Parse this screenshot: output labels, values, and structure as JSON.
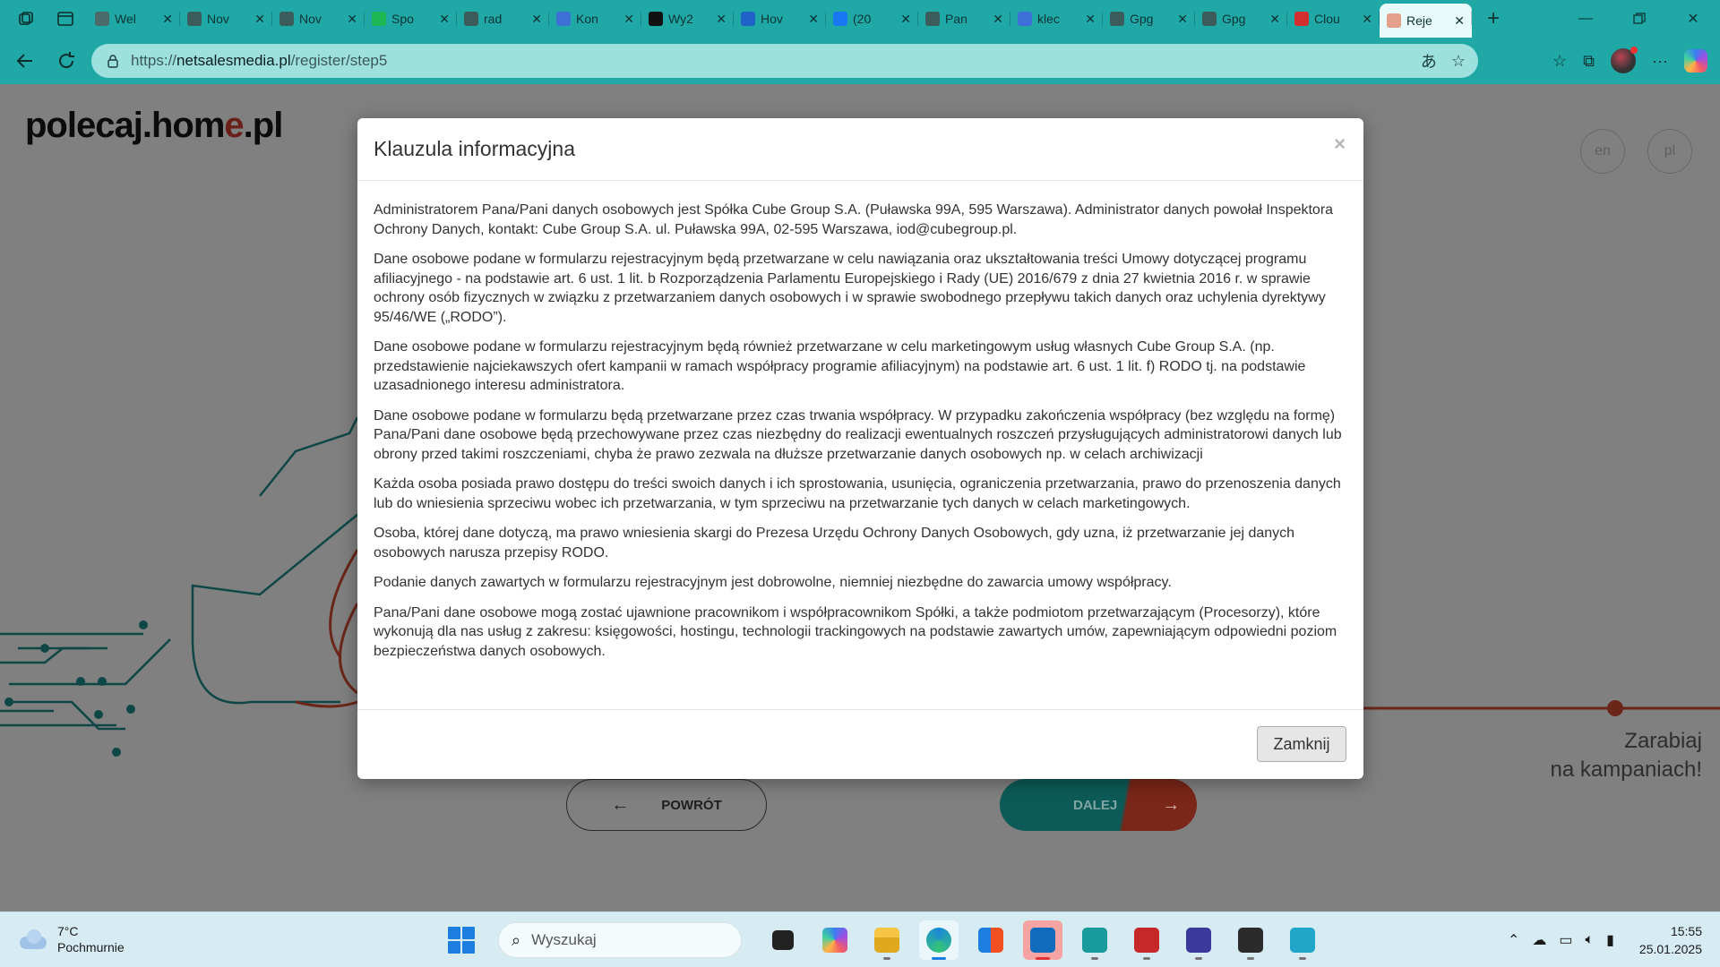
{
  "browser": {
    "tabs": [
      {
        "label": "Wel",
        "color": "#4a6b6a"
      },
      {
        "label": "Nov",
        "color": "#3b5c5b"
      },
      {
        "label": "Nov",
        "color": "#3b5c5b"
      },
      {
        "label": "Spo",
        "color": "#1db954"
      },
      {
        "label": "rad",
        "color": "#3b5c5b"
      },
      {
        "label": "Kon",
        "color": "#3d6fd6"
      },
      {
        "label": "Wy2",
        "color": "#111111"
      },
      {
        "label": "Hov",
        "color": "#1f63c9"
      },
      {
        "label": "(20",
        "color": "#1877f2"
      },
      {
        "label": "Pan",
        "color": "#3b5c5b"
      },
      {
        "label": "klec",
        "color": "#3d6fd6"
      },
      {
        "label": "Gpg",
        "color": "#3b5c5b"
      },
      {
        "label": "Gpg",
        "color": "#3b5c5b"
      },
      {
        "label": "Clou",
        "color": "#d32f2f"
      },
      {
        "label": "Reje",
        "color": "#e2a08d",
        "active": true
      }
    ],
    "url_prefix": "https://",
    "url_domain": "netsalesmedia.pl",
    "url_path": "/register/step5"
  },
  "page": {
    "logo_part1": "polecaj.hom",
    "logo_e": "e",
    "logo_part2": ".pl",
    "lang_en": "en",
    "lang_pl": "pl",
    "tagline_line1": "Zarabiaj",
    "tagline_line2": "na kampaniach!",
    "back_label": "POWRÓT",
    "next_label": "DALEJ"
  },
  "modal": {
    "title": "Klauzula informacyjna",
    "close_symbol": "×",
    "paragraphs": [
      "Administratorem Pana/Pani danych osobowych jest Spółka Cube Group S.A. (Puławska 99A, 595 Warszawa). Administrator danych powołał Inspektora Ochrony Danych, kontakt: Cube Group S.A. ul. Puławska 99A, 02-595 Warszawa, iod@cubegroup.pl.",
      "Dane osobowe podane w formularzu rejestracyjnym będą przetwarzane w celu nawiązania oraz ukształtowania treści Umowy dotyczącej programu afiliacyjnego - na podstawie art. 6 ust. 1 lit. b Rozporządzenia Parlamentu Europejskiego i Rady (UE) 2016/679 z dnia 27 kwietnia 2016 r. w sprawie ochrony osób fizycznych w związku z przetwarzaniem danych osobowych i w sprawie swobodnego przepływu takich danych oraz uchylenia dyrektywy 95/46/WE („RODO”).",
      "Dane osobowe podane w formularzu rejestracyjnym będą również przetwarzane w celu marketingowym usług własnych Cube Group S.A. (np. przedstawienie najciekawszych ofert kampanii w ramach współpracy programie afiliacyjnym) na podstawie art. 6 ust. 1 lit. f) RODO tj. na podstawie uzasadnionego interesu administratora.",
      "Dane osobowe podane w formularzu będą przetwarzane przez czas trwania współpracy. W przypadku zakończenia współpracy (bez względu na formę) Pana/Pani dane osobowe będą przechowywane przez czas niezbędny do realizacji ewentualnych roszczeń przysługujących administratorowi danych lub obrony przed takimi roszczeniami, chyba że prawo zezwala na dłuższe przetwarzanie danych osobowych np. w celach archiwizacji",
      "Każda osoba posiada prawo dostępu do treści swoich danych i ich sprostowania, usunięcia, ograniczenia przetwarzania, prawo do przenoszenia danych lub do wniesienia sprzeciwu wobec ich przetwarzania, w tym sprzeciwu na przetwarzanie tych danych w celach marketingowych.",
      "Osoba, której dane dotyczą, ma prawo wniesienia skargi do Prezesa Urzędu Ochrony Danych Osobowych, gdy uzna, iż przetwarzanie jej danych osobowych narusza przepisy RODO.",
      "Podanie danych zawartych w formularzu rejestracyjnym jest dobrowolne, niemniej niezbędne do zawarcia umowy współpracy.",
      "Pana/Pani dane osobowe mogą zostać ujawnione pracownikom i współpracownikom Spółki, a także podmiotom przetwarzającym (Procesorzy), które wykonują dla nas usług z zakresu: księgowości, hostingu, technologii trackingowych na podstawie zawartych umów, zapewniającym odpowiedni poziom bezpieczeństwa danych osobowych."
    ],
    "close_button": "Zamknij"
  },
  "taskbar": {
    "weather_temp": "7°C",
    "weather_desc": "Pochmurnie",
    "search_placeholder": "Wyszukaj",
    "time": "15:55",
    "date": "25.01.2025"
  },
  "colors": {
    "browser_accent": "#1fa8a6",
    "address_field": "#9ee0de",
    "teal_button": "#0d5b58",
    "red_accent": "#7a2618"
  }
}
